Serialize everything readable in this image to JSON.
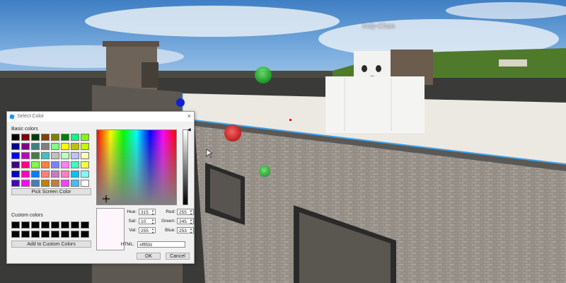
{
  "game": {
    "player_name": "Indy-Chan"
  },
  "dialog": {
    "title": "Select Color",
    "close_symbol": "×",
    "basic_colors_label": "Basic colors",
    "pick_screen_label": "Pick Screen Color",
    "custom_colors_label": "Custom colors",
    "add_custom_label": "Add to Custom Colors",
    "basic_colors": [
      "#000000",
      "#800000",
      "#004000",
      "#804000",
      "#808000",
      "#008000",
      "#00ff80",
      "#80ff00",
      "#000080",
      "#800080",
      "#408080",
      "#808080",
      "#80ff80",
      "#ffff00",
      "#c0c000",
      "#c0ff00",
      "#0000ff",
      "#c000c0",
      "#408040",
      "#40c0c0",
      "#c0c0c0",
      "#c0ffc0",
      "#c0c0ff",
      "#ffffc0",
      "#400080",
      "#ff0080",
      "#80ff40",
      "#ff8040",
      "#8080ff",
      "#ff80ff",
      "#40ffc0",
      "#ffff40",
      "#0000c0",
      "#ff00c0",
      "#0080ff",
      "#ff8080",
      "#c080c0",
      "#ff80c0",
      "#00c0ff",
      "#80ffff",
      "#4000c0",
      "#ff00ff",
      "#4080c0",
      "#c08000",
      "#c08040",
      "#ff40ff",
      "#40c0ff",
      "#ffffff"
    ],
    "custom_colors": [
      "#000000",
      "#000000",
      "#000000",
      "#000000",
      "#000000",
      "#000000",
      "#000000",
      "#000000",
      "#000000",
      "#000000",
      "#000000",
      "#000000",
      "#000000",
      "#000000",
      "#000000",
      "#000000"
    ],
    "selected_color": "#fff5fd",
    "fields": {
      "hue_label": "Hue:",
      "hue": "315",
      "sat_label": "Sat:",
      "sat": "10",
      "val_label": "Val:",
      "val": "255",
      "red_label": "Red:",
      "red": "255",
      "green_label": "Green:",
      "green": "245",
      "blue_label": "Blue:",
      "blue": "253",
      "html_label": "HTML:",
      "html": "#fff5fd"
    },
    "ok_label": "OK",
    "cancel_label": "Cancel"
  }
}
